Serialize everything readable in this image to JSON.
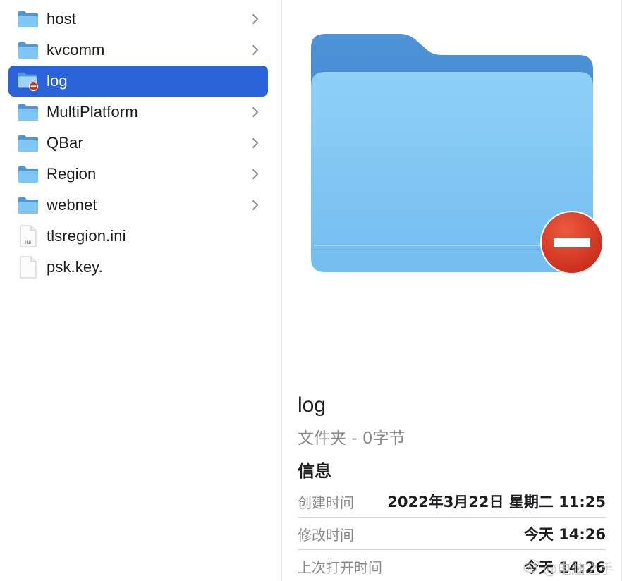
{
  "file_list": {
    "items": [
      {
        "label": "host",
        "type": "folder",
        "icon": "folder-icon",
        "chevron": true,
        "selected": false
      },
      {
        "label": "kvcomm",
        "type": "folder",
        "icon": "folder-icon",
        "chevron": true,
        "selected": false
      },
      {
        "label": "log",
        "type": "folder-restricted",
        "icon": "folder-no-access-icon",
        "chevron": false,
        "selected": true
      },
      {
        "label": "MultiPlatform",
        "type": "folder",
        "icon": "folder-icon",
        "chevron": true,
        "selected": false
      },
      {
        "label": "QBar",
        "type": "folder",
        "icon": "folder-icon",
        "chevron": true,
        "selected": false
      },
      {
        "label": "Region",
        "type": "folder",
        "icon": "folder-icon",
        "chevron": true,
        "selected": false
      },
      {
        "label": "webnet",
        "type": "folder",
        "icon": "folder-icon",
        "chevron": true,
        "selected": false
      },
      {
        "label": "tlsregion.ini",
        "type": "file",
        "icon": "ini-file-icon",
        "file_badge": "INI",
        "chevron": false,
        "selected": false
      },
      {
        "label": "psk.key.",
        "type": "file",
        "icon": "document-icon",
        "chevron": false,
        "selected": false
      }
    ]
  },
  "preview": {
    "name": "log",
    "kind": "文件夹 - 0字节",
    "info_heading": "信息",
    "info": [
      {
        "key": "创建时间",
        "value": "2022年3月22日 星期二 11:25"
      },
      {
        "key": "修改时间",
        "value": "今天 14:26"
      },
      {
        "key": "上次打开时间",
        "value": "今天 14:26"
      }
    ]
  },
  "watermark": {
    "text": "@电脑之手",
    "icon": "weibo-icon"
  },
  "colors": {
    "selection": "#2a63d9",
    "folder_front": "#7cc4f3",
    "folder_back": "#4a8fd6",
    "no_access_badge": "#d8331f"
  }
}
